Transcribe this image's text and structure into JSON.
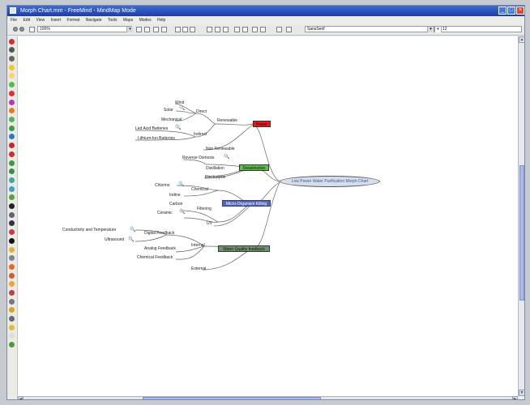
{
  "window": {
    "title": "Morph Chart.mm - FreeMind - MindMap Mode",
    "minimize": "_",
    "maximize": "□",
    "close": "×",
    "icon": "freemind-app-icon"
  },
  "menu": [
    "File",
    "Edit",
    "View",
    "Insert",
    "Format",
    "Navigate",
    "Tools",
    "Maps",
    "Modes",
    "Help"
  ],
  "toolbar": {
    "zoom": "100%",
    "font": "SansSerif",
    "size": "12",
    "dropdown_arrow": "▾"
  },
  "mindmap": {
    "root": "Low Power Water Purification Morph Chart",
    "branches": {
      "power": "Power",
      "desalination": "Desalination",
      "microorganism": "Micro-Organism Killing",
      "water_quality": "Water Quality feedback"
    },
    "power": {
      "renewable": "Renewable",
      "direct": "Direct",
      "wind": "Wind",
      "solar": "Solar",
      "mechanical": "Mechanical",
      "indirect": "Indirect",
      "lead_acid": "Led Acid Batteries",
      "lithium": "Lithium-Ion Batteries",
      "non_renewable": "Non Renewable"
    },
    "desalination": {
      "reverse_osmosis": "Reverse Osmosis",
      "distillation": "Distillation",
      "electrolysis": "Electrolysis"
    },
    "microorganism": {
      "chemical": "Chemical",
      "chlorine": "Chlorine",
      "iodine": "Iodine",
      "filtering": "Filtering",
      "carbon": "Carbon",
      "ceramic": "Ceramic",
      "uv": "UV"
    },
    "water_quality": {
      "internal": "Internal",
      "digital": "Digital Feedback",
      "conductivity": "Conductivity and Temperature",
      "ultrasound": "Ultrasound",
      "analog": "Analog Feedback",
      "chemical_feedback": "Chemical Feedback",
      "external": "External"
    },
    "colors": {
      "power": "#e51b20",
      "desalination": "#5ebd4b",
      "microorganism": "#5667bc",
      "water_quality": "#71936f",
      "line": "#666666",
      "root_fill": "#d8dee6"
    },
    "attachment_icon": "magnifier-icon"
  }
}
